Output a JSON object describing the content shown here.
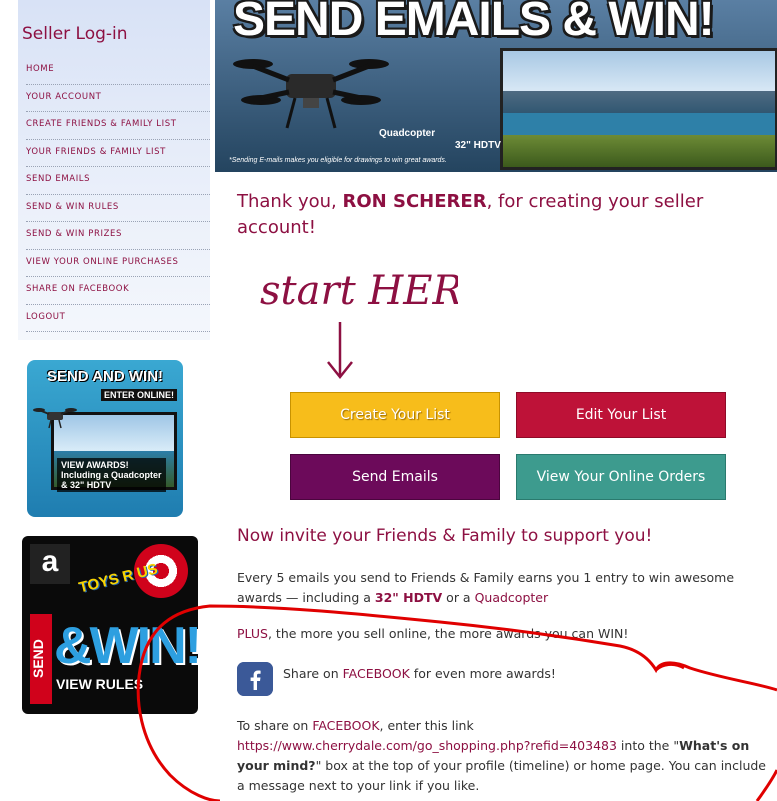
{
  "sidebar": {
    "title": "Seller Log-in",
    "menu": [
      "HOME",
      "YOUR ACCOUNT",
      "CREATE FRIENDS & FAMILY LIST",
      "YOUR FRIENDS & FAMILY LIST",
      "SEND EMAILS",
      "SEND & WIN RULES",
      "SEND & WIN PRIZES",
      "VIEW YOUR ONLINE PURCHASES",
      "SHARE ON FACEBOOK",
      "LOGOUT"
    ],
    "promo1": {
      "headline": "SEND AND WIN!",
      "sub": "ENTER ONLINE!",
      "awards_line1": "VIEW AWARDS!",
      "awards_line2": "Including a Quadcopter",
      "awards_line3": "& 32\" HDTV"
    },
    "promo2": {
      "amazon": "a",
      "toysrus": "TOYS R US",
      "send": "SEND",
      "win": "&WIN!",
      "rules": "VIEW RULES"
    }
  },
  "banner": {
    "title": "SEND EMAILS & WIN!",
    "caption_quad": "Quadcopter",
    "caption_tv": "32\" HDTV",
    "fine_print": "*Sending E-mails makes you eligible for drawings to win great awards."
  },
  "main": {
    "thanks_prefix": "Thank you, ",
    "seller_name": "RON SCHERER",
    "thanks_suffix": ", for creating your seller account!",
    "start_text": "start HERE",
    "buttons": {
      "create": "Create Your List",
      "edit": "Edit Your List",
      "send": "Send Emails",
      "view": "View Your Online Orders"
    },
    "invite_heading": "Now invite your Friends & Family to support you!",
    "para1_a": "Every 5 emails you send to Friends & Family earns you 1 entry to win awesome awards — including a ",
    "para1_hdtv": "32\" HDTV",
    "para1_or": " or a ",
    "para1_quad": "Quadcopter",
    "para2_plus": "PLUS",
    "para2_rest": ", the more you sell online, the more awards you can WIN!",
    "fb_prefix": "Share on ",
    "fb_link": "FACEBOOK",
    "fb_suffix": " for even more awards!",
    "share_prefix": "To share on ",
    "share_fb": "FACEBOOK",
    "share_mid": ", enter this link",
    "share_url": "https://www.cherrydale.com/go_shopping.php?refid=403483",
    "share_into": " into the \"",
    "share_box": "What's on your mind?",
    "share_end": "\" box at the top of your profile (timeline) or home page. You can include a message next to your link if you like."
  },
  "colors": {
    "accent": "#8d1042",
    "create_button": "#f7bd1b",
    "edit_button": "#be1238",
    "send_button": "#6c0a5a",
    "view_button": "#3d9b8e",
    "facebook": "#3b5998",
    "annotation": "#e00000"
  },
  "icons": {
    "facebook": "facebook-icon",
    "arrow": "down-arrow-icon"
  }
}
